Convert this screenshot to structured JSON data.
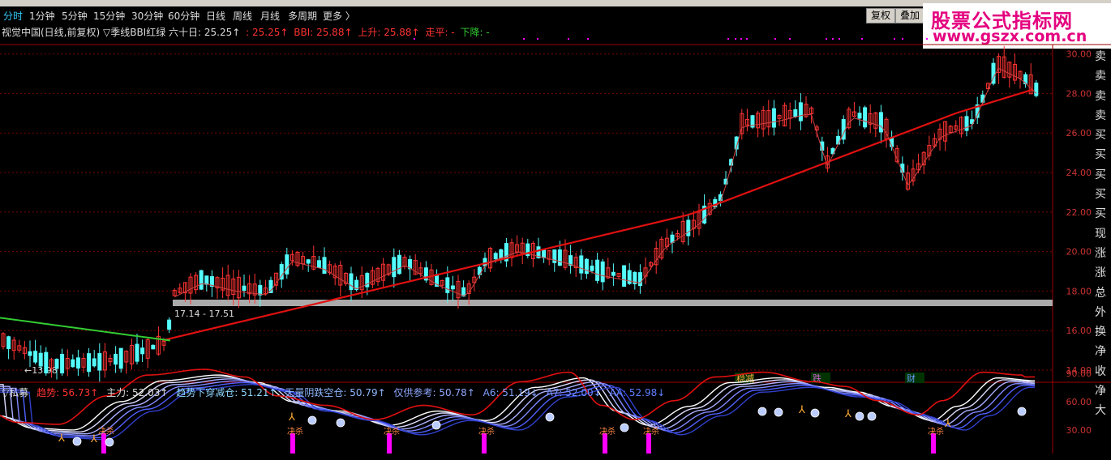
{
  "toolbar": {
    "tabs": [
      "分时",
      "1分钟",
      "5分钟",
      "15分钟",
      "30分钟",
      "60分钟",
      "日线",
      "周线",
      "月线",
      "多周期",
      "更多 〉"
    ],
    "buttons": [
      "复权",
      "叠加"
    ]
  },
  "watermark": {
    "title": "股票公式指标网",
    "url": "www.gszx.com.cn"
  },
  "info": {
    "title": "视觉中国(日线,前复权) ▽季线BBI红绿 六十日: 25.25↑",
    "v1": ": 25.25↑",
    "bbi": "BBI: 25.88↑",
    "up": "上升: 25.88↑",
    "flat": "走平: -",
    "down": "下降: -"
  },
  "price_axis": [
    "30.00",
    "28.00",
    "26.00",
    "24.00",
    "22.00",
    "20.00",
    "18.00",
    "16.00",
    "14.00"
  ],
  "right_list": [
    "卖",
    "卖",
    "卖",
    "卖",
    "买",
    "买",
    "买",
    "买",
    "买",
    "现",
    "涨",
    "涨",
    "总",
    "外",
    "换",
    "净",
    "收",
    "净",
    "大"
  ],
  "annotations": {
    "range": "17.14 - 17.51",
    "low": "←13.98"
  },
  "events": [
    "稳减",
    "跌",
    "财"
  ],
  "indicator": {
    "name": "▽私募",
    "trend": "趋势: 56.73↑",
    "main": "主力: 52.03↑",
    "down_hold": "趋势下穿减仓: 51.21↑",
    "no_fall": "无量阴跌空仓: 50.79↑",
    "ref": "仅供参考: 50.78↑",
    "a6": "A6: 51.19↓",
    "a7": "A7: 52.00↓",
    "aa": "AA: 52.98↓",
    "axis": [
      "90.00",
      "60.00",
      "30.00"
    ],
    "signal": "决杀"
  },
  "colors": {
    "up": "#ff3333",
    "down": "#54fcfc",
    "ma_red": "#e01010",
    "green": "#33cc33",
    "magenta": "#ff00ff"
  }
}
